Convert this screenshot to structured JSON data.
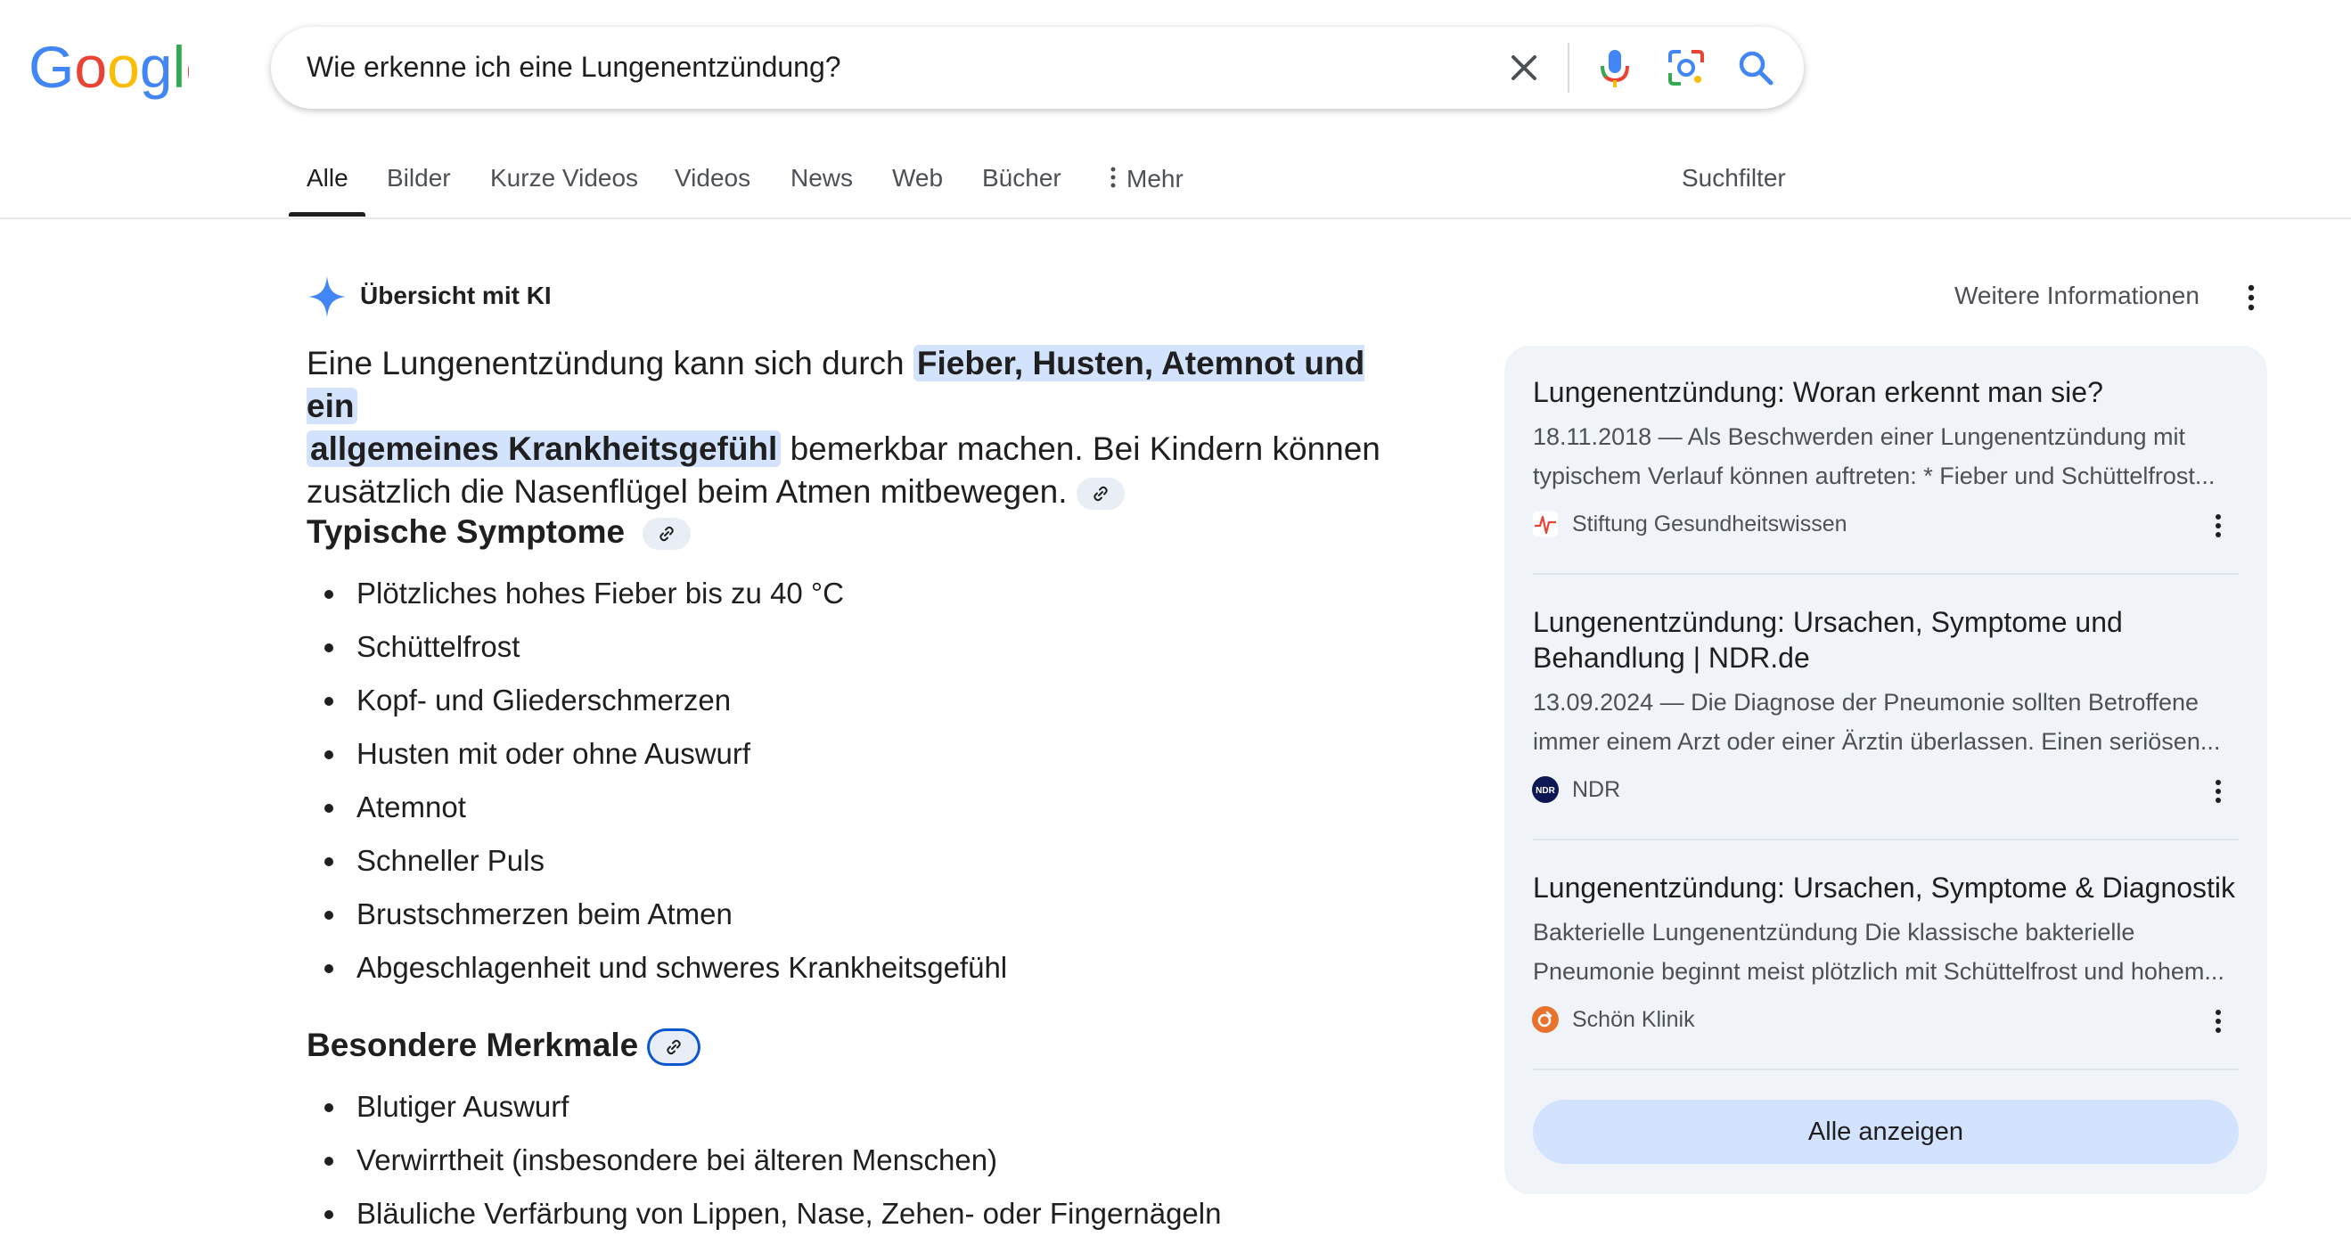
{
  "search": {
    "query": "Wie erkenne ich eine Lungenentzündung?"
  },
  "tabs": [
    {
      "label": "Alle"
    },
    {
      "label": "Bilder"
    },
    {
      "label": "Kurze Videos"
    },
    {
      "label": "Videos"
    },
    {
      "label": "News"
    },
    {
      "label": "Web"
    },
    {
      "label": "Bücher"
    },
    {
      "label": "Mehr"
    }
  ],
  "active_tab": "Alle",
  "search_filter_label": "Suchfilter",
  "ai_overview": {
    "title": "Übersicht mit KI",
    "more_info": "Weitere Informationen",
    "lead_text_1": "Eine Lungenentzündung kann sich durch",
    "lead_highlight_1": "Fieber, Husten, Atemnot und ein",
    "lead_highlight_2": "allgemeines Krankheitsgefühl",
    "lead_text_2": "bemerkbar machen. Bei Kindern können",
    "lead_text_3": "zusätzlich die Nasenflügel beim Atmen mitbewegen.",
    "section_1": {
      "title": "Typische Symptome",
      "items": [
        "Plötzliches hohes Fieber bis zu 40 °C",
        "Schüttelfrost",
        "Kopf- und Gliederschmerzen",
        "Husten mit oder ohne Auswurf",
        "Atemnot",
        "Schneller Puls",
        "Brustschmerzen beim Atmen",
        "Abgeschlagenheit und schweres Krankheitsgefühl"
      ]
    },
    "section_2": {
      "title": "Besondere Merkmale",
      "items": [
        "Blutiger Auswurf",
        "Verwirrtheit (insbesondere bei älteren Menschen)",
        "Bläuliche Verfärbung von Lippen, Nase, Zehen- oder Fingernägeln"
      ]
    }
  },
  "sources": [
    {
      "title": "Lungenentzündung: Woran erkennt man sie?",
      "snippet_1": "18.11.2018 — Als Beschwerden einer Lungenentzündung mit",
      "snippet_2": "typischem Verlauf können auftreten: * Fieber und Schüttelfrost...",
      "source": "Stiftung Gesundheitswissen"
    },
    {
      "title_1": "Lungenentzündung: Ursachen, Symptome und",
      "title_2": "Behandlung | NDR.de",
      "snippet_1": "13.09.2024 — Die Diagnose der Pneumonie sollten Betroffene",
      "snippet_2": "immer einem Arzt oder einer Ärztin überlassen. Einen seriösen...",
      "source": "NDR",
      "favicon_text": "NDR"
    },
    {
      "title": "Lungenentzündung: Ursachen, Symptome & Diagnostik",
      "snippet_1": "Bakterielle Lungenentzündung Die klassische bakterielle",
      "snippet_2": "Pneumonie beginnt meist plötzlich mit Schüttelfrost und hohem...",
      "source": "Schön Klinik"
    }
  ],
  "show_all_label": "Alle anzeigen",
  "colors": {
    "google_blue": "#4285F4",
    "google_red": "#EA4335",
    "google_yellow": "#FBBC05",
    "google_green": "#34A853",
    "highlight": "#d3e3fd",
    "card_bg": "#f0f4f9"
  },
  "icons": [
    "google-logo",
    "clear-icon",
    "mic-icon",
    "lens-icon",
    "search-icon",
    "dots-vertical-icon",
    "sparkle-icon",
    "link-icon"
  ]
}
